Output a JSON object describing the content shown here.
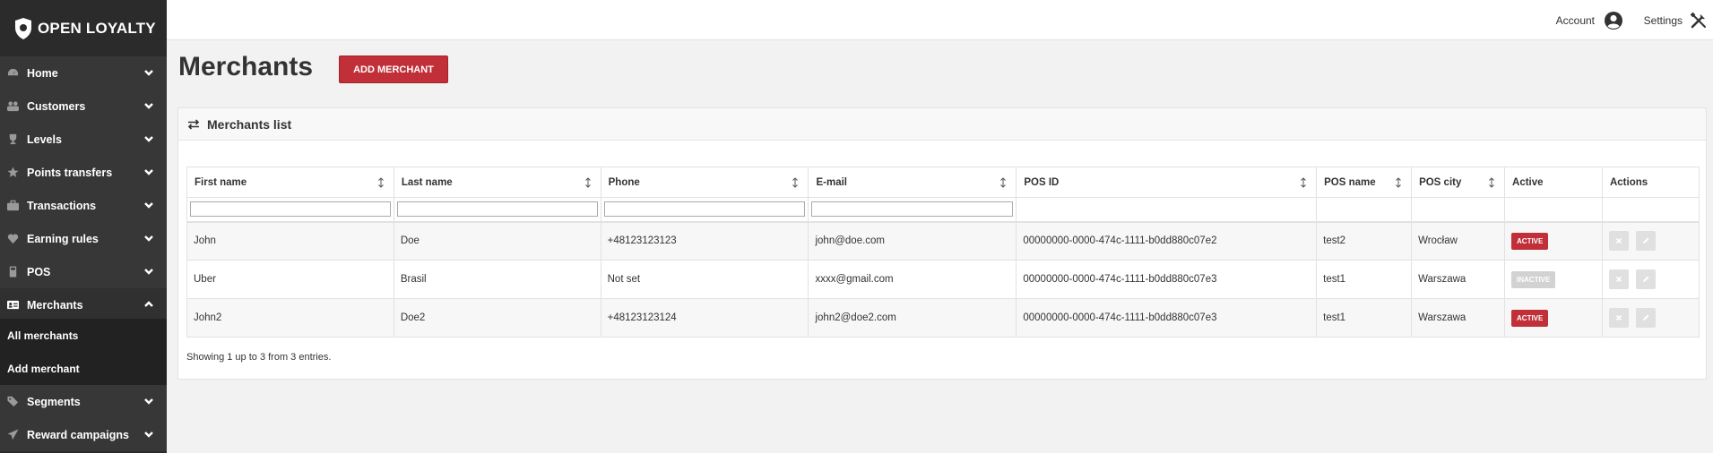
{
  "brand": {
    "name": "OPEN LOYALTY"
  },
  "sidebar": {
    "items": [
      {
        "label": "Home",
        "icon": "dashboard-icon"
      },
      {
        "label": "Customers",
        "icon": "users-icon"
      },
      {
        "label": "Levels",
        "icon": "trophy-icon"
      },
      {
        "label": "Points transfers",
        "icon": "star-icon"
      },
      {
        "label": "Transactions",
        "icon": "briefcase-icon"
      },
      {
        "label": "Earning rules",
        "icon": "heart-icon"
      },
      {
        "label": "POS",
        "icon": "pos-icon"
      },
      {
        "label": "Merchants",
        "icon": "id-card-icon"
      },
      {
        "label": "Segments",
        "icon": "tags-icon"
      },
      {
        "label": "Reward campaigns",
        "icon": "send-icon"
      }
    ],
    "merchant_sub": [
      "All merchants",
      "Add merchant"
    ]
  },
  "topbar": {
    "account": "Account",
    "settings": "Settings"
  },
  "page": {
    "title": "Merchants",
    "add_button": "ADD MERCHANT"
  },
  "panel": {
    "title": "Merchants list",
    "columns": [
      "First name",
      "Last name",
      "Phone",
      "E-mail",
      "POS ID",
      "POS name",
      "POS city",
      "Active",
      "Actions"
    ],
    "rows": [
      {
        "first": "John",
        "last": "Doe",
        "phone": "+48123123123",
        "email": "john@doe.com",
        "pos_id": "00000000-0000-474c-1111-b0dd880c07e2",
        "pos_name": "test2",
        "city": "Wrocław",
        "status": "ACTIVE"
      },
      {
        "first": "Uber",
        "last": "Brasil",
        "phone": "Not set",
        "email": "xxxx@gmail.com",
        "pos_id": "00000000-0000-474c-1111-b0dd880c07e3",
        "pos_name": "test1",
        "city": "Warszawa",
        "status": "INACTIVE"
      },
      {
        "first": "John2",
        "last": "Doe2",
        "phone": "+48123123124",
        "email": "john2@doe2.com",
        "pos_id": "00000000-0000-474c-1111-b0dd880c07e3",
        "pos_name": "test1",
        "city": "Warszawa",
        "status": "ACTIVE"
      }
    ],
    "summary": "Showing 1 up to 3 from 3 entries."
  },
  "colors": {
    "accent": "#c12f38",
    "sidebar": "#373737",
    "inactive": "#d2d2d2"
  }
}
